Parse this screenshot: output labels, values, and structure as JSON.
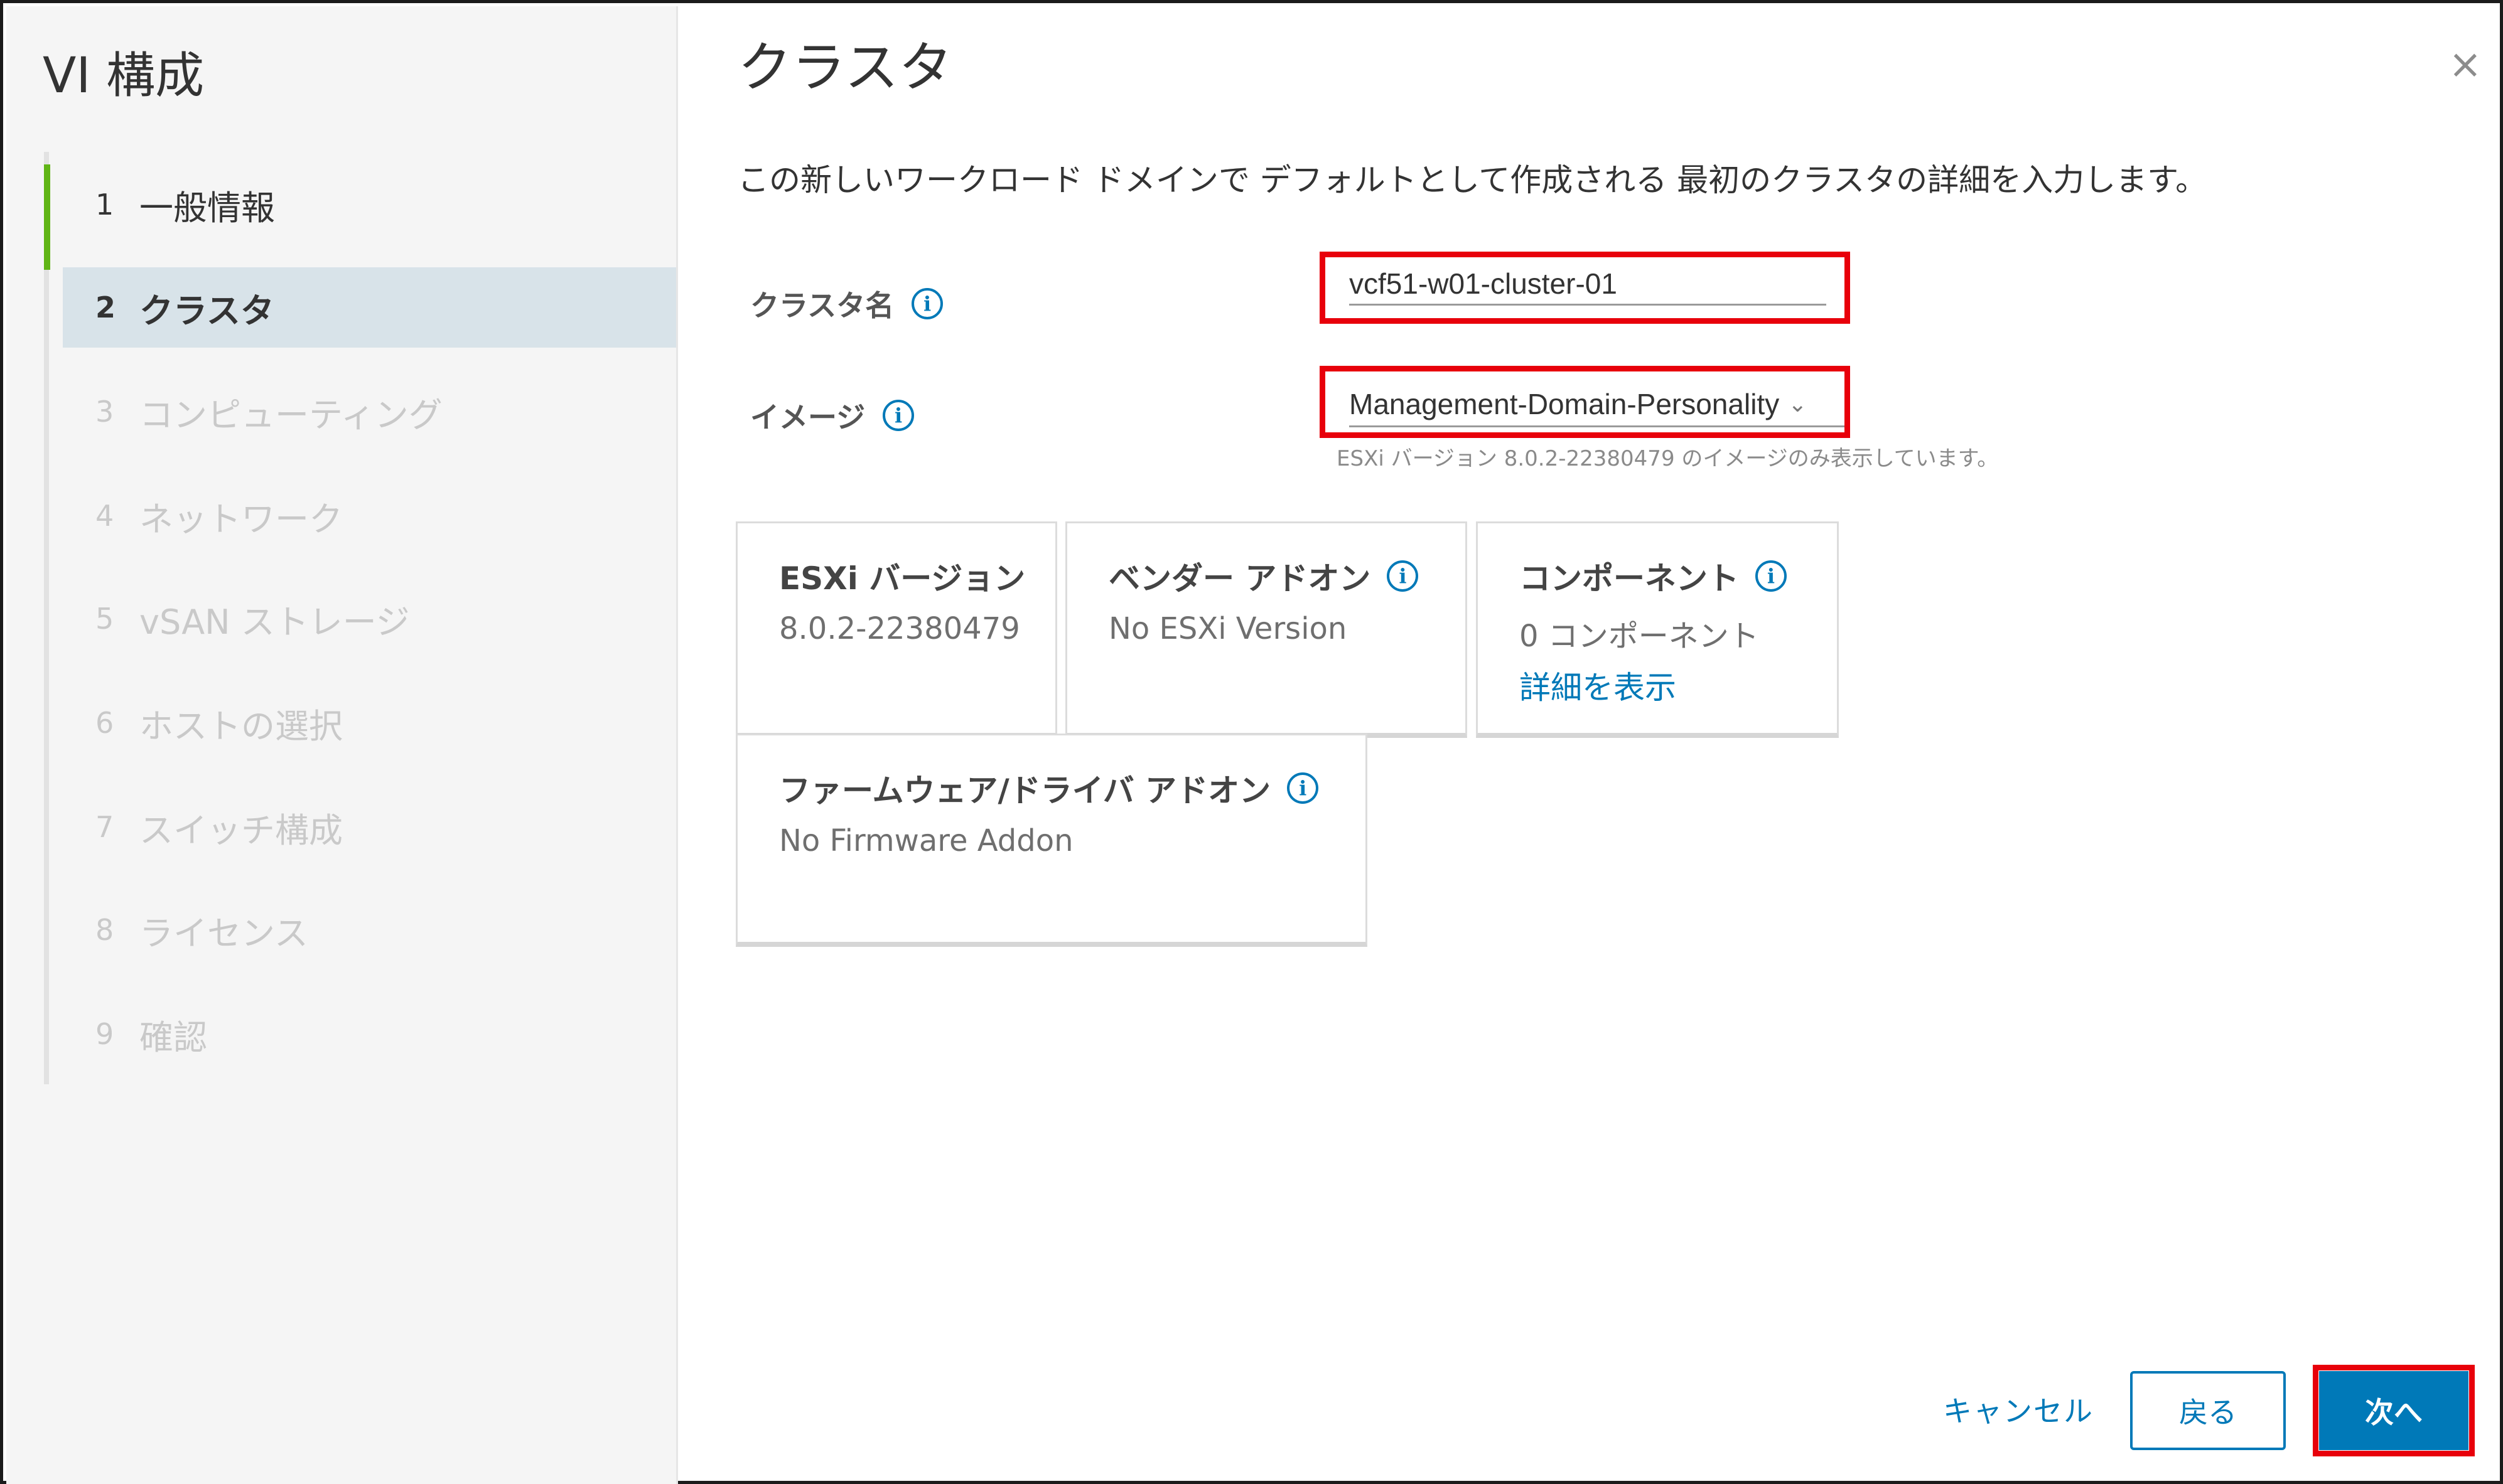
{
  "wizard": {
    "title": "VI 構成",
    "steps": [
      {
        "num": "1",
        "label": "一般情報",
        "state": "done"
      },
      {
        "num": "2",
        "label": "クラスタ",
        "state": "active"
      },
      {
        "num": "3",
        "label": "コンピューティング",
        "state": "pending"
      },
      {
        "num": "4",
        "label": "ネットワーク",
        "state": "pending"
      },
      {
        "num": "5",
        "label": "vSAN ストレージ",
        "state": "pending"
      },
      {
        "num": "6",
        "label": "ホストの選択",
        "state": "pending"
      },
      {
        "num": "7",
        "label": "スイッチ構成",
        "state": "pending"
      },
      {
        "num": "8",
        "label": "ライセンス",
        "state": "pending"
      },
      {
        "num": "9",
        "label": "確認",
        "state": "pending"
      }
    ]
  },
  "page": {
    "title": "クラスタ",
    "description": "この新しいワークロード ドメインで デフォルトとして作成される 最初のクラスタの詳細を入力します。",
    "close_icon": "×"
  },
  "form": {
    "cluster_name_label": "クラスタ名",
    "cluster_name_value": "vcf51-w01-cluster-01",
    "image_label": "イメージ",
    "image_value": "Management-Domain-Personality",
    "image_hint": "ESXi バージョン 8.0.2-22380479 のイメージのみ表示しています。"
  },
  "cards": {
    "esxi": {
      "title": "ESXi バージョン",
      "value": "8.0.2-22380479"
    },
    "vendor": {
      "title": "ベンダー アドオン",
      "value": "No ESXi Version"
    },
    "components": {
      "title": "コンポーネント",
      "value": "0 コンポーネント",
      "link": "詳細を表示"
    },
    "firmware": {
      "title": "ファームウェア/ドライバ アドオン",
      "value": "No Firmware Addon"
    }
  },
  "footer": {
    "cancel": "キャンセル",
    "back": "戻る",
    "next": "次へ"
  },
  "colors": {
    "accent": "#0079b8",
    "completed": "#60b515",
    "active_step_bg": "#d8e3e9",
    "highlight": "#e8000b"
  }
}
